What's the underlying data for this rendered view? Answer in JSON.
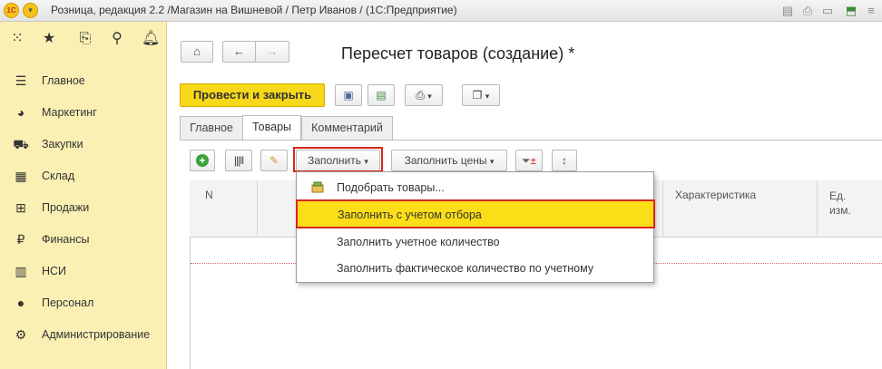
{
  "titlebar": {
    "logo": "1С",
    "text": "Розница, редакция 2.2 /Магазин на Вишневой / Петр Иванов /  (1С:Предприятие)",
    "icons": [
      "list-icon",
      "print-icon",
      "document-icon",
      "notification-icon",
      "menu-icon"
    ]
  },
  "sidebar": {
    "top_icons": [
      "apps-grid-icon",
      "star-icon",
      "history-icon",
      "search-icon",
      "bell-icon"
    ],
    "items": [
      {
        "label": "Главное",
        "icon": "menu-lines-icon"
      },
      {
        "label": "Маркетинг",
        "icon": "pie-chart-icon"
      },
      {
        "label": "Закупки",
        "icon": "cart-in-icon"
      },
      {
        "label": "Склад",
        "icon": "warehouse-icon"
      },
      {
        "label": "Продажи",
        "icon": "basket-icon"
      },
      {
        "label": "Финансы",
        "icon": "ruble-icon"
      },
      {
        "label": "НСИ",
        "icon": "books-icon"
      },
      {
        "label": "Персонал",
        "icon": "person-icon"
      },
      {
        "label": "Администрирование",
        "icon": "gear-icon"
      }
    ]
  },
  "document": {
    "title": "Пересчет товаров (создание) *"
  },
  "toolbar": {
    "post_close_label": "Провести и закрыть"
  },
  "tabs": [
    {
      "label": "Главное",
      "active": false
    },
    {
      "label": "Товары",
      "active": true
    },
    {
      "label": "Комментарий",
      "active": false
    }
  ],
  "goods_toolbar": {
    "fill_label": "Заполнить",
    "fill_prices_label": "Заполнить цены"
  },
  "table": {
    "columns": [
      "N",
      "Характеристика",
      "Ед.\nизм."
    ]
  },
  "fill_menu": {
    "items": [
      {
        "label": "Подобрать товары...",
        "highlighted": false
      },
      {
        "label": "Заполнить с учетом отбора",
        "highlighted": true
      },
      {
        "label": "Заполнить учетное количество",
        "highlighted": false
      },
      {
        "label": "Заполнить фактическое количество по учетному",
        "highlighted": false
      }
    ]
  },
  "colors": {
    "sidebar_bg": "#fbf0b4",
    "accent_yellow": "#f7d81a",
    "highlight_red": "#d9261c"
  }
}
